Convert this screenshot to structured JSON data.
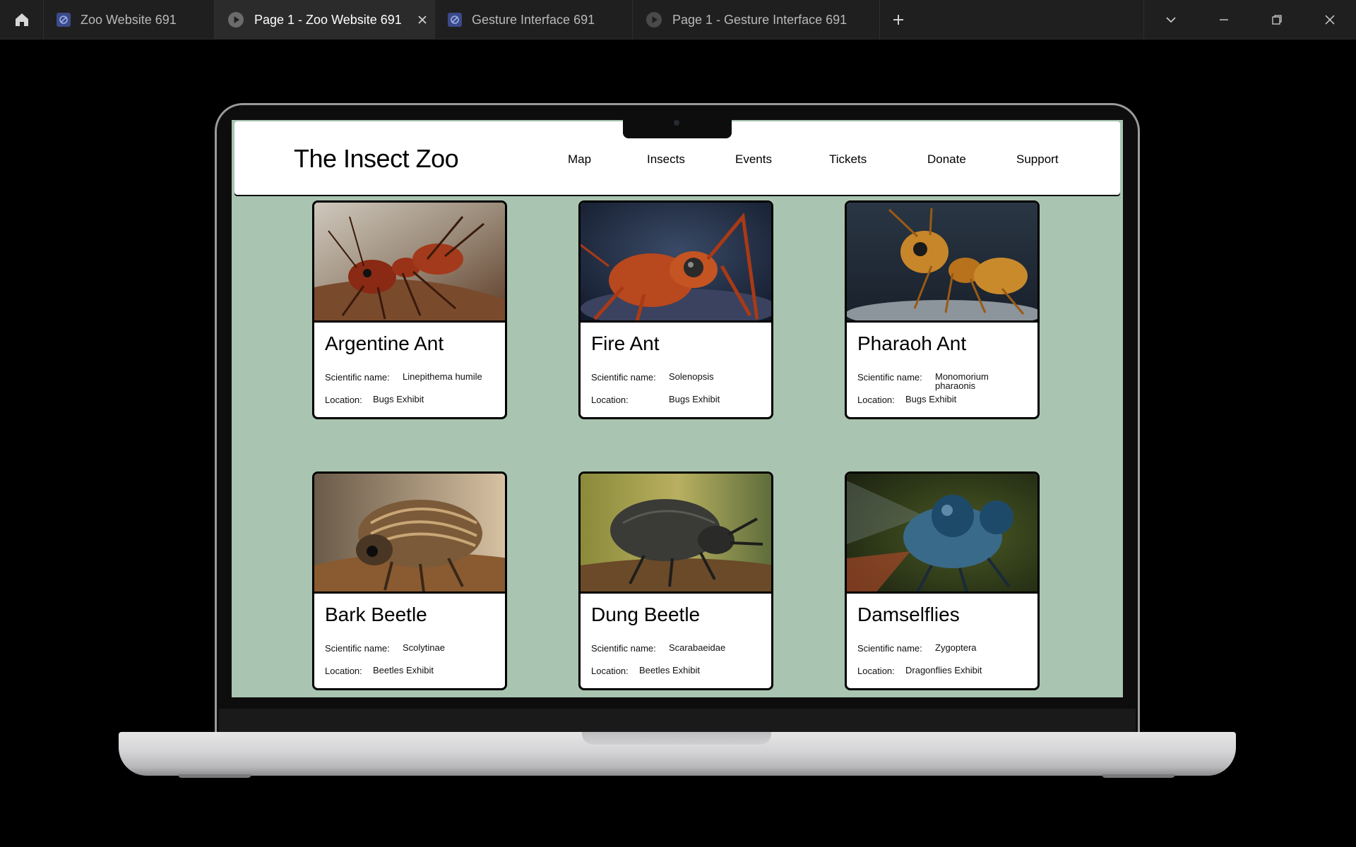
{
  "browser": {
    "home_icon": "home-icon",
    "tabs": [
      {
        "label": "Zoo Website 691",
        "icon": "figma-file-icon",
        "active": false
      },
      {
        "label": "Page 1 - Zoo Website 691",
        "icon": "play-icon",
        "active": true
      },
      {
        "label": "Gesture Interface 691",
        "icon": "figma-file-icon",
        "active": false
      },
      {
        "label": "Page 1 - Gesture Interface 691",
        "icon": "play-icon",
        "active": false
      }
    ],
    "new_tab_icon": "plus-icon",
    "window_controls": [
      "chevron-down-icon",
      "minimize-icon",
      "restore-icon",
      "close-icon"
    ]
  },
  "site": {
    "title": "The Insect Zoo",
    "nav": [
      "Map",
      "Insects",
      "Events",
      "Tickets",
      "Donate",
      "Support"
    ],
    "background_color": "#a9c4b0",
    "cards": [
      {
        "name": "Argentine Ant",
        "sci_label": "Scientific name:",
        "sci_value": "Linepithema humile",
        "loc_label": "Location:",
        "loc_value": "Bugs Exhibit"
      },
      {
        "name": "Fire Ant",
        "sci_label": "Scientific name:",
        "sci_value": "Solenopsis",
        "loc_label": "Location:",
        "loc_value": "Bugs Exhibit"
      },
      {
        "name": "Pharaoh Ant",
        "sci_label": "Scientific name:",
        "sci_value": "Monomorium pharaonis",
        "loc_label": "Location:",
        "loc_value": "Bugs Exhibit"
      },
      {
        "name": "Bark Beetle",
        "sci_label": "Scientific name:",
        "sci_value": "Scolytinae",
        "loc_label": "Location:",
        "loc_value": "Beetles Exhibit"
      },
      {
        "name": "Dung Beetle",
        "sci_label": "Scientific name:",
        "sci_value": "Scarabaeidae",
        "loc_label": "Location:",
        "loc_value": "Beetles Exhibit"
      },
      {
        "name": "Damselflies",
        "sci_label": "Scientific name:",
        "sci_value": "Zygoptera",
        "loc_label": "Location:",
        "loc_value": "Dragonflies Exhibit"
      }
    ]
  }
}
